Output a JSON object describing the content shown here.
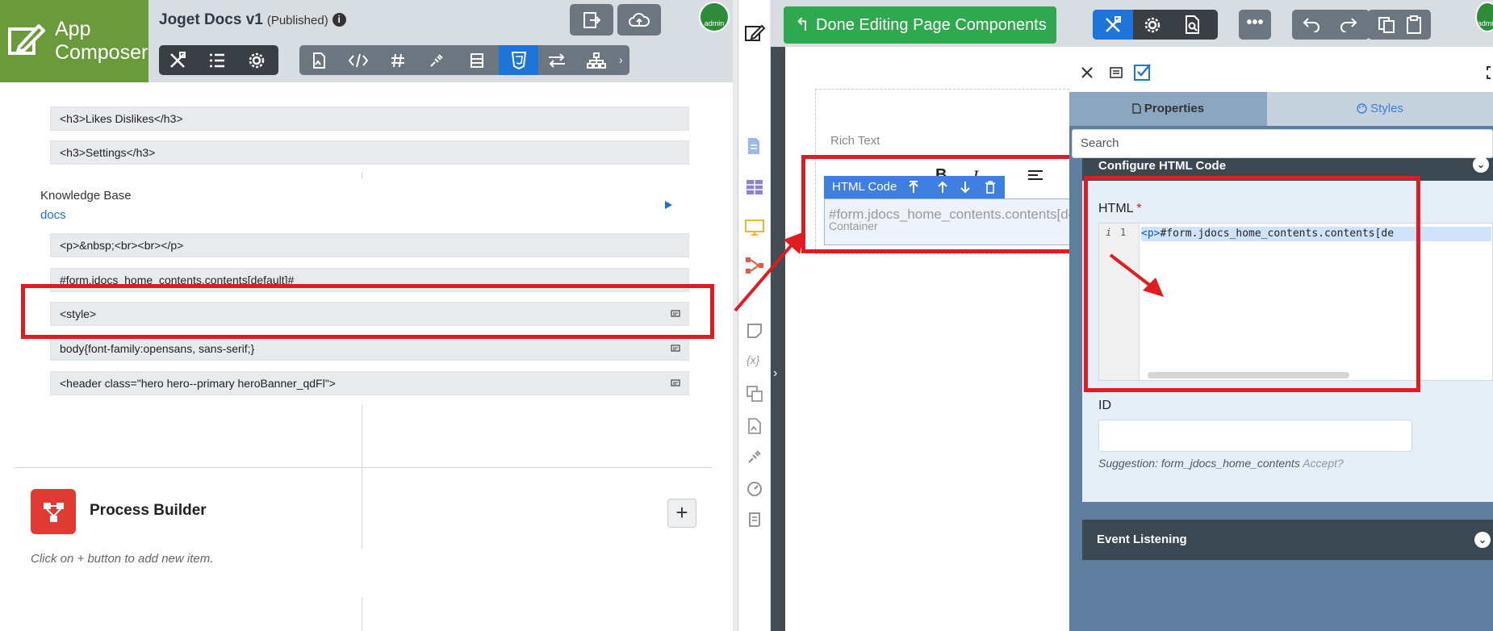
{
  "left": {
    "brand": {
      "title_line1": "App",
      "title_line2": "Composer"
    },
    "app_title": "Joget Docs v1",
    "app_status": "(Published)",
    "rows_top": [
      "<h3>Likes Dislikes</h3>",
      "<h3>Settings</h3>"
    ],
    "kb_title": "Knowledge Base",
    "kb_link": "docs",
    "rows_mid": [
      "<p>&nbsp;<br><br></p>",
      "#form.jdocs_home_contents.contents[default]#",
      "<style>",
      "body{font-family:opensans, sans-serif;}",
      "<header class=\"hero hero--primary heroBanner_qdFl\">"
    ],
    "process_builder": {
      "title": "Process Builder",
      "hint": "Click on + button to add new item."
    }
  },
  "right": {
    "done_label": "Done Editing Page Components",
    "canvas": {
      "rich_text_label": "Rich Text",
      "element_bar_label": "HTML Code",
      "element_text": "#form.jdocs_home_contents.contents[default]#",
      "element_sub": "Container"
    },
    "panel": {
      "tab_properties": "Properties",
      "tab_styles": "Styles",
      "search_placeholder": "Search",
      "section_title": "Configure HTML Code",
      "html_label": "HTML",
      "required_mark": "*",
      "line_number": "1",
      "code_tag": "<p>",
      "code_text": "#form.jdocs_home_contents.contents[de",
      "id_label": "ID",
      "suggestion_text": "Suggestion: form_jdocs_home_contents",
      "accept_label": "Accept?",
      "event_title": "Event Listening"
    }
  },
  "colors": {
    "brand_green": "#6a9a3c",
    "done_green": "#2fa84f",
    "accent_blue": "#1e74d9",
    "highlight_red": "#e01b22"
  }
}
